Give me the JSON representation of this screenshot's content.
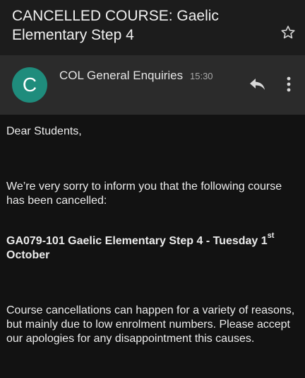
{
  "email": {
    "subject": "CANCELLED COURSE: Gaelic Elementary Step 4",
    "sender": {
      "initial": "C",
      "name": "COL General Enquiries",
      "time": "15:30",
      "avatar_color": "#1f8c7c"
    },
    "body": {
      "greeting": "Dear Students,",
      "intro": "We’re very sorry to inform you that the following course has been cancelled:",
      "course_main": "GA079-101 Gaelic Elementary Step 4 - Tuesday 1",
      "course_superscript": "st",
      "course_tail": " October",
      "note": "Course cancellations can happen for a variety of reasons, but mainly due to low enrolment numbers. Please accept our apologies for any disappointment this causes."
    }
  },
  "icons": {
    "star": "star-outline-icon",
    "reply": "reply-icon",
    "more": "more-vertical-icon"
  }
}
